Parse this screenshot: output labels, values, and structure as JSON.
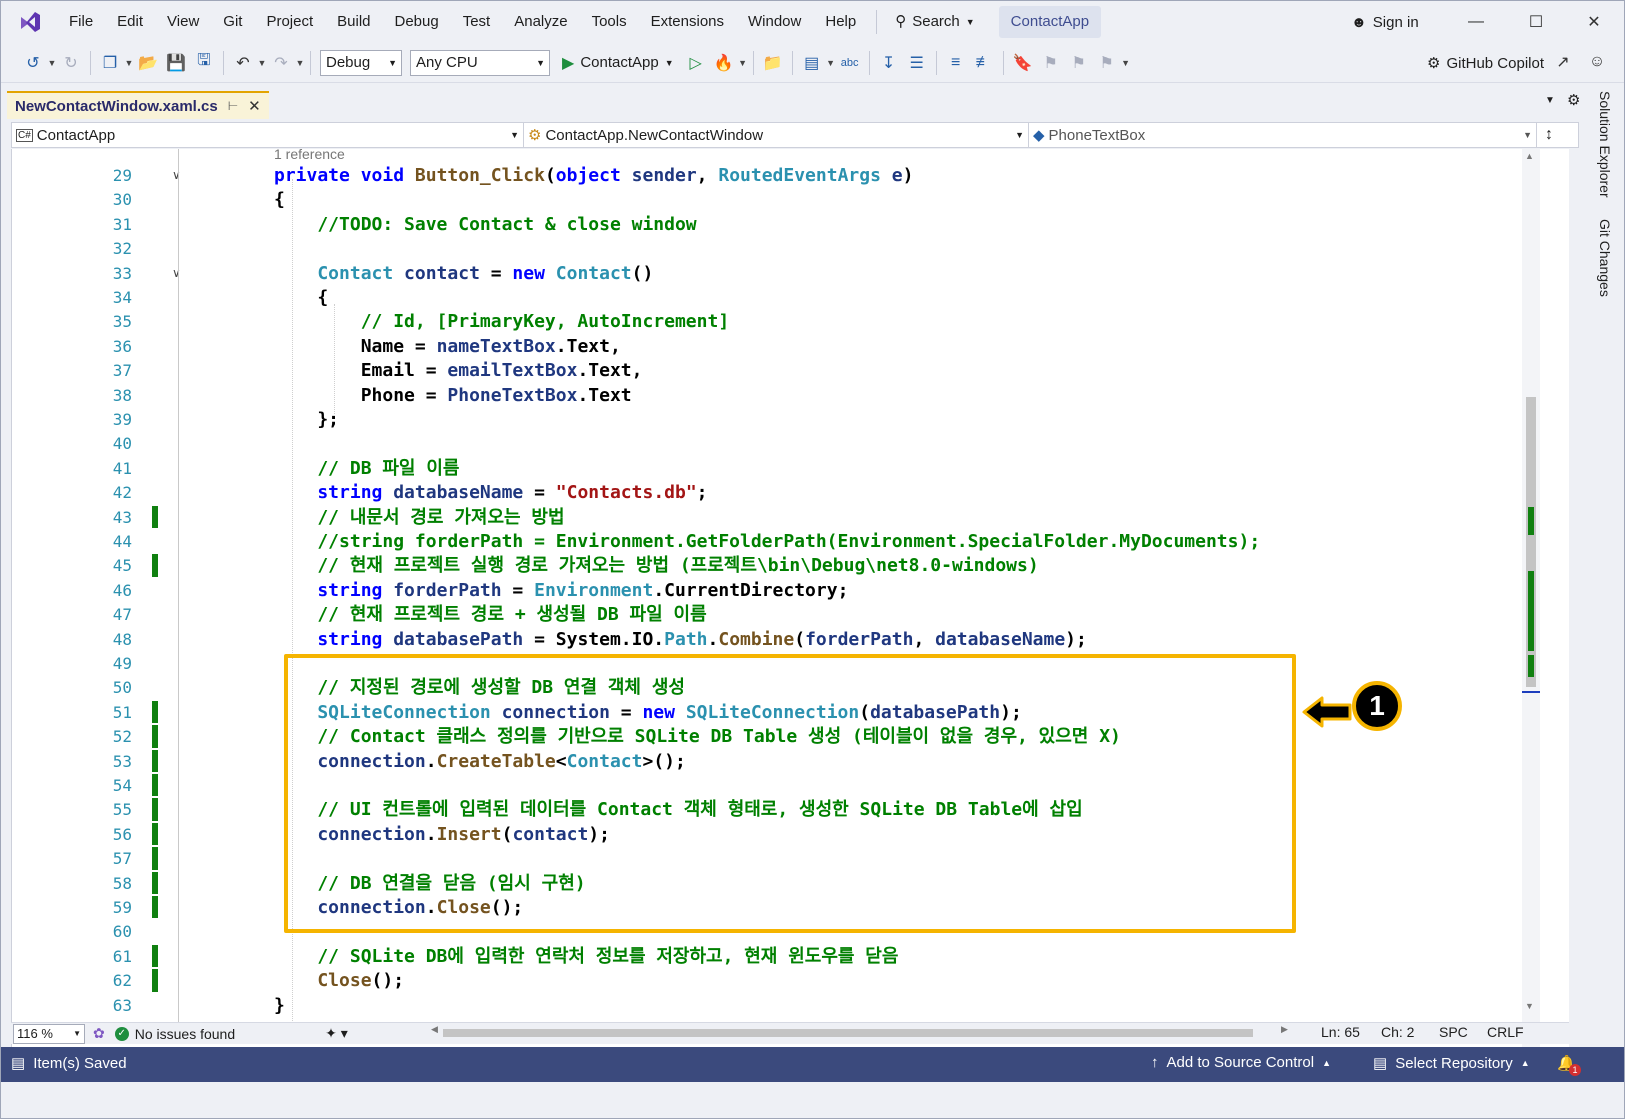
{
  "menu": {
    "items": [
      "File",
      "Edit",
      "View",
      "Git",
      "Project",
      "Build",
      "Debug",
      "Test",
      "Analyze",
      "Tools",
      "Extensions",
      "Window",
      "Help"
    ],
    "search_label": "Search",
    "project_name": "ContactApp",
    "sign_in": "Sign in"
  },
  "toolbar": {
    "config": "Debug",
    "platform": "Any CPU",
    "run_target": "ContactApp",
    "copilot": "GitHub Copilot"
  },
  "tab": {
    "title": "NewContactWindow.xaml.cs"
  },
  "navbar": {
    "project": "ContactApp",
    "class": "ContactApp.NewContactWindow",
    "member": "PhoneTextBox"
  },
  "rail": {
    "solution_explorer": "Solution Explorer",
    "git_changes": "Git Changes"
  },
  "editor": {
    "codelens": "1 reference",
    "line_numbers": [
      "29",
      "30",
      "31",
      "32",
      "33",
      "34",
      "35",
      "36",
      "37",
      "38",
      "39",
      "40",
      "41",
      "42",
      "43",
      "44",
      "45",
      "46",
      "47",
      "48",
      "49",
      "50",
      "51",
      "52",
      "53",
      "54",
      "55",
      "56",
      "57",
      "58",
      "59",
      "60",
      "61",
      "62",
      "63"
    ],
    "changed_lines": [
      "43",
      "45",
      "51",
      "52",
      "53",
      "54",
      "55",
      "56",
      "57",
      "58",
      "59",
      "61",
      "62"
    ],
    "lines": [
      [
        [
          "kw",
          "private "
        ],
        [
          "kw",
          "void "
        ],
        [
          "fn",
          "Button_Click"
        ],
        [
          "pl",
          "("
        ],
        [
          "kw",
          "object "
        ],
        [
          "id",
          "sender"
        ],
        [
          "pl",
          ", "
        ],
        [
          "ty",
          "RoutedEventArgs "
        ],
        [
          "id",
          "e"
        ],
        [
          "pl",
          ")"
        ]
      ],
      [
        [
          "pl",
          "{"
        ]
      ],
      [
        [
          "cm",
          "    //TODO: Save Contact & close window"
        ]
      ],
      [
        [
          "pl",
          ""
        ]
      ],
      [
        [
          "ty",
          "    Contact "
        ],
        [
          "id",
          "contact"
        ],
        [
          "pl",
          " = "
        ],
        [
          "kw",
          "new "
        ],
        [
          "ty",
          "Contact"
        ],
        [
          "pl",
          "()"
        ]
      ],
      [
        [
          "pl",
          "    {"
        ]
      ],
      [
        [
          "cm",
          "        // Id, [PrimaryKey, AutoIncrement]"
        ]
      ],
      [
        [
          "pl",
          "        Name = "
        ],
        [
          "id",
          "nameTextBox"
        ],
        [
          "pl",
          "."
        ],
        [
          "pl",
          "Text,"
        ]
      ],
      [
        [
          "pl",
          "        Email = "
        ],
        [
          "id",
          "emailTextBox"
        ],
        [
          "pl",
          "."
        ],
        [
          "pl",
          "Text,"
        ]
      ],
      [
        [
          "pl",
          "        Phone = "
        ],
        [
          "id",
          "PhoneTextBox"
        ],
        [
          "pl",
          "."
        ],
        [
          "pl",
          "Text"
        ]
      ],
      [
        [
          "pl",
          "    };"
        ]
      ],
      [
        [
          "pl",
          ""
        ]
      ],
      [
        [
          "cm",
          "    // DB 파일 이름"
        ]
      ],
      [
        [
          "kw",
          "    string "
        ],
        [
          "id",
          "databaseName"
        ],
        [
          "pl",
          " = "
        ],
        [
          "st",
          "\"Contacts.db\""
        ],
        [
          "pl",
          ";"
        ]
      ],
      [
        [
          "cm",
          "    // 내문서 경로 가져오는 방법"
        ]
      ],
      [
        [
          "cm",
          "    //string forderPath = Environment.GetFolderPath(Environment.SpecialFolder.MyDocuments);"
        ]
      ],
      [
        [
          "cm",
          "    // 현재 프로젝트 실행 경로 가져오는 방법 (프로젝트\\bin\\Debug\\net8.0-windows)"
        ]
      ],
      [
        [
          "kw",
          "    string "
        ],
        [
          "id",
          "forderPath"
        ],
        [
          "pl",
          " = "
        ],
        [
          "ty",
          "Environment"
        ],
        [
          "pl",
          "."
        ],
        [
          "pl",
          "CurrentDirectory;"
        ]
      ],
      [
        [
          "cm",
          "    // 현재 프로젝트 경로 + 생성될 DB 파일 이름"
        ]
      ],
      [
        [
          "kw",
          "    string "
        ],
        [
          "id",
          "databasePath"
        ],
        [
          "pl",
          " = System.IO."
        ],
        [
          "ty",
          "Path"
        ],
        [
          "pl",
          "."
        ],
        [
          "fn",
          "Combine"
        ],
        [
          "pl",
          "("
        ],
        [
          "id",
          "forderPath"
        ],
        [
          "pl",
          ", "
        ],
        [
          "id",
          "databaseName"
        ],
        [
          "pl",
          ");"
        ]
      ],
      [
        [
          "pl",
          ""
        ]
      ],
      [
        [
          "cm",
          "    // 지정된 경로에 생성할 DB 연결 객체 생성"
        ]
      ],
      [
        [
          "ty",
          "    SQLiteConnection "
        ],
        [
          "id",
          "connection"
        ],
        [
          "pl",
          " = "
        ],
        [
          "kw",
          "new "
        ],
        [
          "ty",
          "SQLiteConnection"
        ],
        [
          "pl",
          "("
        ],
        [
          "id",
          "databasePath"
        ],
        [
          "pl",
          ");"
        ]
      ],
      [
        [
          "cm",
          "    // Contact 클래스 정의를 기반으로 SQLite DB Table 생성 (테이블이 없을 경우, 있으면 X)"
        ]
      ],
      [
        [
          "id",
          "    connection"
        ],
        [
          "pl",
          "."
        ],
        [
          "fn",
          "CreateTable"
        ],
        [
          "pl",
          "<"
        ],
        [
          "ty",
          "Contact"
        ],
        [
          "pl",
          ">();"
        ]
      ],
      [
        [
          "pl",
          ""
        ]
      ],
      [
        [
          "cm",
          "    // UI 컨트롤에 입력된 데이터를 Contact 객체 형태로, 생성한 SQLite DB Table에 삽입"
        ]
      ],
      [
        [
          "id",
          "    connection"
        ],
        [
          "pl",
          "."
        ],
        [
          "fn",
          "Insert"
        ],
        [
          "pl",
          "("
        ],
        [
          "id",
          "contact"
        ],
        [
          "pl",
          ");"
        ]
      ],
      [
        [
          "pl",
          ""
        ]
      ],
      [
        [
          "cm",
          "    // DB 연결을 닫음 (임시 구현)"
        ]
      ],
      [
        [
          "id",
          "    connection"
        ],
        [
          "pl",
          "."
        ],
        [
          "fn",
          "Close"
        ],
        [
          "pl",
          "();"
        ]
      ],
      [
        [
          "pl",
          ""
        ]
      ],
      [
        [
          "cm",
          "    // SQLite DB에 입력한 연락처 정보를 저장하고, 현재 윈도우를 닫음"
        ]
      ],
      [
        [
          "fn",
          "    Close"
        ],
        [
          "pl",
          "();"
        ]
      ],
      [
        [
          "pl",
          "}"
        ]
      ]
    ],
    "callout_number": "1"
  },
  "editor_status": {
    "zoom": "116 %",
    "issues": "No issues found",
    "line": "Ln: 65",
    "col": "Ch: 2",
    "whitespace": "SPC",
    "line_ending": "CRLF"
  },
  "statusbar": {
    "saved": "Item(s) Saved",
    "source_control": "Add to Source Control",
    "repository": "Select Repository",
    "notifications": "1"
  },
  "colors": {
    "highlight": "#f5b400",
    "status_bar": "#3b4a7d",
    "change_marker": "#108010"
  }
}
